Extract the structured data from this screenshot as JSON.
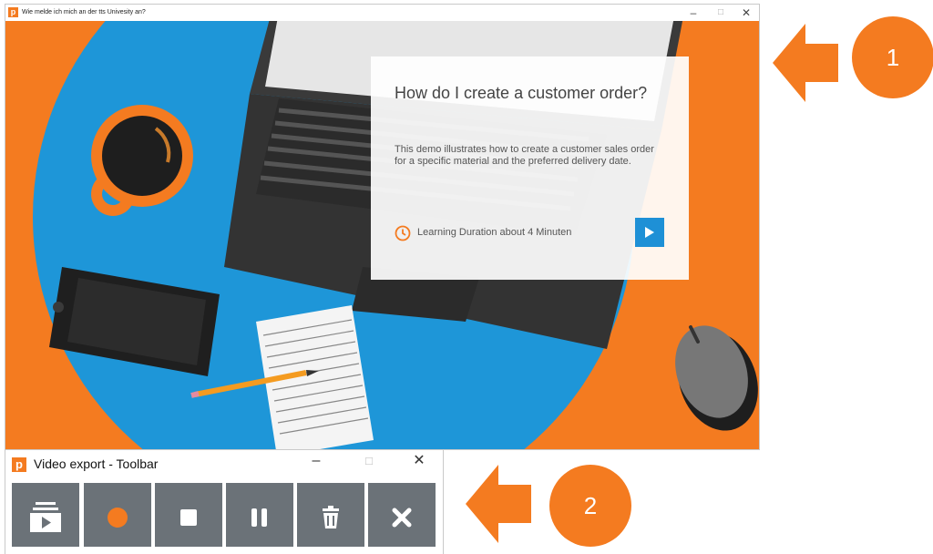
{
  "main_window": {
    "title": "Wie melde ich mich an der tts Univesity an?",
    "controls": [
      "–",
      "□",
      "✕"
    ]
  },
  "card": {
    "title": "How do I create a customer order?",
    "description": "This demo illustrates how to create a customer sales order for a specific material and the preferred delivery date.",
    "duration": "Learning Duration about 4 Minuten",
    "play_icon": "play-icon"
  },
  "annotations": [
    {
      "number": "1",
      "icon": "arrow-left-icon"
    },
    {
      "number": "2",
      "icon": "arrow-left-icon"
    }
  ],
  "toolbar_window": {
    "logo": "p",
    "title": "Video export - Toolbar",
    "controls": [
      "–",
      "□",
      "✕"
    ],
    "buttons": [
      {
        "icon": "video-export-icon"
      },
      {
        "icon": "record-icon"
      },
      {
        "icon": "stop-icon"
      },
      {
        "icon": "pause-icon"
      },
      {
        "icon": "trash-icon"
      },
      {
        "icon": "close-icon"
      }
    ]
  },
  "colors": {
    "accent_orange": "#f47b20",
    "scene_blue": "#1e96d8",
    "play_blue": "#1e90d6",
    "toolbar_button": "#6b7278"
  }
}
